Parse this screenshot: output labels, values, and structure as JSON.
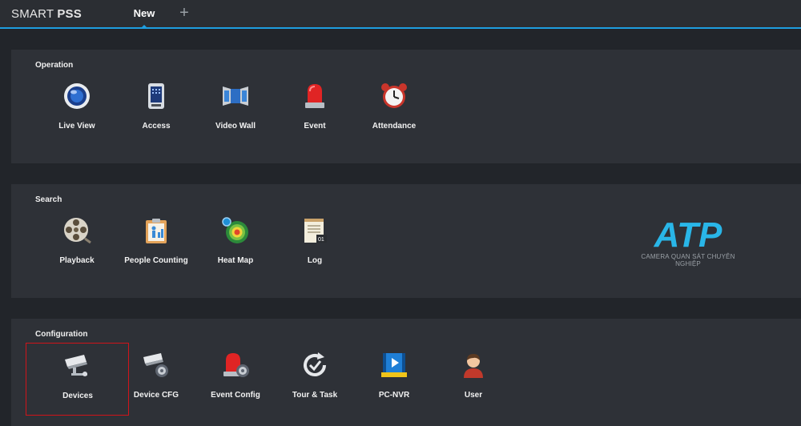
{
  "header": {
    "app_title_prefix": "SMART",
    "app_title_bold": "PSS",
    "tab_label": "New",
    "add_tab_symbol": "+"
  },
  "sections": {
    "operation": {
      "title": "Operation",
      "items": [
        {
          "label": "Live View",
          "icon": "live-view-icon"
        },
        {
          "label": "Access",
          "icon": "access-control-icon"
        },
        {
          "label": "Video Wall",
          "icon": "video-wall-icon"
        },
        {
          "label": "Event",
          "icon": "alarm-light-icon"
        },
        {
          "label": "Attendance",
          "icon": "alarm-clock-icon"
        }
      ]
    },
    "search": {
      "title": "Search",
      "items": [
        {
          "label": "Playback",
          "icon": "film-reel-icon"
        },
        {
          "label": "People Counting",
          "icon": "people-counting-icon"
        },
        {
          "label": "Heat Map",
          "icon": "heat-map-icon"
        },
        {
          "label": "Log",
          "icon": "log-notepad-icon"
        }
      ]
    },
    "configuration": {
      "title": "Configuration",
      "items": [
        {
          "label": "Devices",
          "icon": "camera-icon",
          "selected": true
        },
        {
          "label": "Device CFG",
          "icon": "camera-gear-icon"
        },
        {
          "label": "Event Config",
          "icon": "alarm-gear-icon"
        },
        {
          "label": "Tour & Task",
          "icon": "tour-task-icon"
        },
        {
          "label": "PC-NVR",
          "icon": "pc-nvr-icon"
        },
        {
          "label": "User",
          "icon": "user-icon"
        }
      ]
    }
  },
  "watermark": {
    "logo_text": "ATP",
    "tagline": "CAMERA QUAN SÁT CHUYÊN NGHIỆP"
  },
  "colors": {
    "accent": "#1e9ee0",
    "selection": "#d0141a",
    "logo": "#29b6e8"
  }
}
